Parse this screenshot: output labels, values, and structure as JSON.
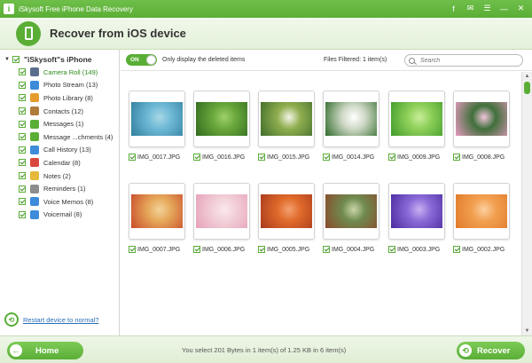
{
  "window": {
    "title": "iSkysoft Free iPhone Data Recovery",
    "logo_letter": "i"
  },
  "header": {
    "title": "Recover from iOS device"
  },
  "sidebar": {
    "device": "\"iSkysoft\"s iPhone",
    "items": [
      {
        "label": "Camera Roll (149)",
        "icon": "camera-icon",
        "color": "#5a6e8c",
        "active": true
      },
      {
        "label": "Photo Stream (13)",
        "icon": "photo-stream-icon",
        "color": "#3d8bd9"
      },
      {
        "label": "Photo Library (8)",
        "icon": "photo-library-icon",
        "color": "#e69b2c"
      },
      {
        "label": "Contacts (12)",
        "icon": "contacts-icon",
        "color": "#b07a3b"
      },
      {
        "label": "Messages (1)",
        "icon": "messages-icon",
        "color": "#5aae36"
      },
      {
        "label": "Message ...chments (4)",
        "icon": "attachment-icon",
        "color": "#5aae36"
      },
      {
        "label": "Call History (13)",
        "icon": "phone-icon",
        "color": "#3d8bd9"
      },
      {
        "label": "Calendar (8)",
        "icon": "calendar-icon",
        "color": "#d9463d"
      },
      {
        "label": "Notes (2)",
        "icon": "notes-icon",
        "color": "#e6b83c"
      },
      {
        "label": "Reminders (1)",
        "icon": "reminders-icon",
        "color": "#8c8c8c"
      },
      {
        "label": "Voice Memos (8)",
        "icon": "voice-memo-icon",
        "color": "#3d8bd9"
      },
      {
        "label": "Voicemail (8)",
        "icon": "voicemail-icon",
        "color": "#3d8bd9"
      }
    ],
    "restart_link": "Restart device to normal?"
  },
  "toolbar": {
    "toggle_label": "ON",
    "toggle_option": "Only display the deleted items",
    "files_filtered": "Files Filtered: 1 item(s)",
    "search_placeholder": "Search"
  },
  "photos": [
    {
      "name": "IMG_0017.JPG",
      "colors": [
        "#6fb9d6",
        "#2f7f9e",
        "#a8d8e6"
      ]
    },
    {
      "name": "IMG_0016.JPG",
      "colors": [
        "#6aa83c",
        "#2f6a1e",
        "#9fd06a"
      ]
    },
    {
      "name": "IMG_0015.JPG",
      "colors": [
        "#8fae4f",
        "#3f6b2a",
        "#f4f4e6"
      ]
    },
    {
      "name": "IMG_0014.JPG",
      "colors": [
        "#cfd9c6",
        "#2f6a2a",
        "#ffffff"
      ]
    },
    {
      "name": "IMG_0009.JPG",
      "colors": [
        "#8fd05a",
        "#3f9a2a",
        "#c9ee9a"
      ]
    },
    {
      "name": "IMG_0008.JPG",
      "colors": [
        "#3f6f3a",
        "#e69ac0",
        "#f2c4dc"
      ]
    },
    {
      "name": "IMG_0007.JPG",
      "colors": [
        "#e6a85a",
        "#c84a2a",
        "#f2d29a"
      ]
    },
    {
      "name": "IMG_0006.JPG",
      "colors": [
        "#f2d0d8",
        "#e6a0b8",
        "#fbe8ee"
      ]
    },
    {
      "name": "IMG_0005.JPG",
      "colors": [
        "#e06a2a",
        "#a83a1e",
        "#f2a070"
      ]
    },
    {
      "name": "IMG_0004.JPG",
      "colors": [
        "#6f8a4f",
        "#8a4a2a",
        "#c9d6a8"
      ]
    },
    {
      "name": "IMG_0003.JPG",
      "colors": [
        "#8a6ad6",
        "#4a2a9e",
        "#c9b0f2"
      ]
    },
    {
      "name": "IMG_0002.JPG",
      "colors": [
        "#f2a050",
        "#e07a2a",
        "#fbd0a0"
      ]
    }
  ],
  "footer": {
    "home_label": "Home",
    "status": "You select 201 Bytes in 1 item(s) of 1.25 KB in 6 item(s)",
    "recover_label": "Recover"
  },
  "colors": {
    "accent": "#5aae36",
    "link": "#2a6fb8"
  }
}
